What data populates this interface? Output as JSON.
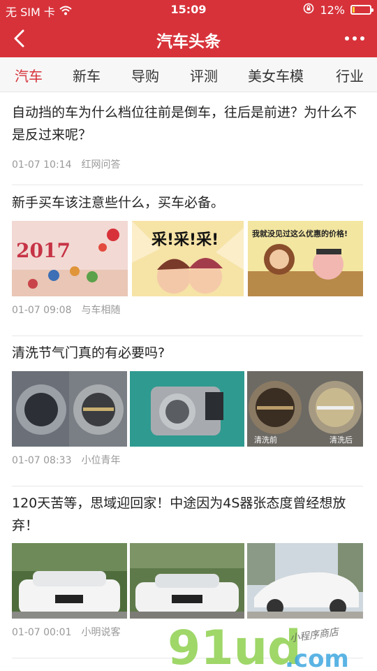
{
  "status_bar": {
    "carrier": "无 SIM 卡",
    "time": "15:09",
    "battery": "12%",
    "battery_level": 0.12,
    "icons": [
      "wifi-icon",
      "rotation-lock-icon",
      "battery-icon"
    ]
  },
  "navbar": {
    "title": "汽车头条",
    "back_icon": "back-chevron-icon",
    "more_icon": "more-dots-icon"
  },
  "tabs": [
    {
      "label": "汽车",
      "active": true
    },
    {
      "label": "新车",
      "active": false
    },
    {
      "label": "导购",
      "active": false
    },
    {
      "label": "评测",
      "active": false
    },
    {
      "label": "美女车模",
      "active": false
    },
    {
      "label": "行业",
      "active": false
    }
  ],
  "articles": [
    {
      "title": "自动挡的车为什么档位往前是倒车，往后是前进？为什么不是反过来呢？",
      "date": "01-07 10:14",
      "source": "红网问答",
      "images": []
    },
    {
      "title": "新手买车该注意些什么，买车必备。",
      "date": "01-07 09:08",
      "source": "与车相随",
      "images": [
        {
          "caption": "2017"
        },
        {
          "caption": "采!采!采!"
        },
        {
          "caption": "我就没见过这么优惠的价格!"
        }
      ]
    },
    {
      "title": "清洗节气门真的有必要吗?",
      "date": "01-07 08:33",
      "source": "小位青年",
      "images": [
        {
          "caption": ""
        },
        {
          "caption": ""
        },
        {
          "caption_left": "清洗前",
          "caption_right": "清洗后"
        }
      ]
    },
    {
      "title": "120天苦等，思域迎回家！中途因为4S器张态度曾经想放弃！",
      "date": "01-07 00:01",
      "source": "小明说客",
      "images": [
        {
          "caption": ""
        },
        {
          "caption": ""
        },
        {
          "caption": ""
        }
      ]
    }
  ],
  "watermark": {
    "brand": "91ud",
    "domain": ".com",
    "tagline": "小程序商店"
  },
  "colors": {
    "brand_red": "#d7323a",
    "active_tab": "#d7323a",
    "meta_gray": "#999999"
  }
}
